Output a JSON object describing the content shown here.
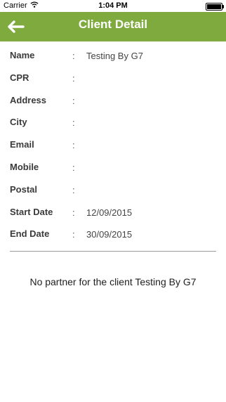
{
  "status_bar": {
    "carrier": "Carrier",
    "time": "1:04 PM"
  },
  "header": {
    "title": "Client Detail",
    "back_icon": "back-arrow-icon"
  },
  "details": [
    {
      "label": "Name",
      "value": "Testing By G7"
    },
    {
      "label": "CPR",
      "value": ""
    },
    {
      "label": "Address",
      "value": ""
    },
    {
      "label": "City",
      "value": ""
    },
    {
      "label": "Email",
      "value": ""
    },
    {
      "label": "Mobile",
      "value": ""
    },
    {
      "label": "Postal",
      "value": ""
    },
    {
      "label": "Start Date",
      "value": "12/09/2015"
    },
    {
      "label": "End Date",
      "value": "30/09/2015"
    }
  ],
  "separator": ":",
  "message": "No partner for the client Testing By G7",
  "colors": {
    "nav_bar": "#7fab3e",
    "title_text": "#ffffff"
  }
}
